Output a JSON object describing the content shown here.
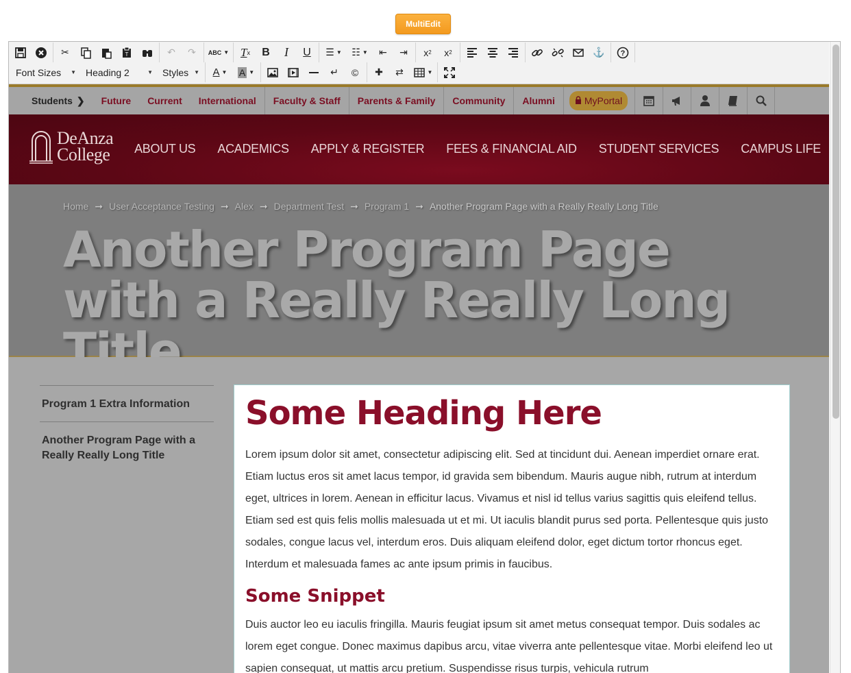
{
  "multiedit": {
    "label": "MultiEdit"
  },
  "toolbar": {
    "font_sizes": "Font Sizes",
    "format": "Heading 2",
    "styles": "Styles"
  },
  "audience": {
    "label": "Students",
    "items": [
      "Future",
      "Current",
      "International",
      "Faculty & Staff",
      "Parents & Family",
      "Community",
      "Alumni"
    ],
    "myportal": "MyPortal",
    "icons": [
      "calendar-icon",
      "megaphone-icon",
      "user-icon",
      "book-icon",
      "search-icon"
    ]
  },
  "brand": {
    "logo_line1": "DeAnza",
    "logo_line2": "College",
    "nav": [
      "ABOUT US",
      "ACADEMICS",
      "APPLY & REGISTER",
      "FEES & FINANCIAL AID",
      "STUDENT SERVICES",
      "CAMPUS LIFE"
    ]
  },
  "breadcrumb": {
    "items": [
      "Home",
      "User Acceptance Testing",
      "Alex",
      "Department Test",
      "Program 1"
    ],
    "current": "Another Program Page with a Really Really Long Title"
  },
  "hero": {
    "title": "Another Program Page with a Really Really Long Title"
  },
  "sidenav": {
    "items": [
      "Program 1 Extra Information",
      "Another Program Page with a Really Really Long Title"
    ]
  },
  "content": {
    "heading": "Some Heading Here",
    "para1": "Lorem ipsum dolor sit amet, consectetur adipiscing elit. Sed at tincidunt dui. Aenean imperdiet ornare erat. Etiam luctus eros sit amet lacus tempor, id gravida sem bibendum. Mauris augue nibh, rutrum at interdum eget, ultrices in lorem. Aenean in efficitur lacus. Vivamus et nisl id tellus varius sagittis quis eleifend tellus. Etiam sed est quis felis mollis malesuada ut et mi. Ut iaculis blandit purus sed porta. Pellentesque quis justo sodales, congue lacus vel, interdum eros. Duis aliquam eleifend dolor, eget dictum tortor rhoncus eget. Interdum et malesuada fames ac ante ipsum primis in faucibus.",
    "subheading": "Some Snippet",
    "para2": "Duis auctor leo eu iaculis fringilla. Mauris feugiat ipsum sit amet metus consequat tempor. Duis sodales ac lorem eget congue. Donec maximus dapibus arcu, vitae viverra ante pellentesque vitae. Morbi eleifend leo ut sapien consequat, ut mattis arcu pretium. Suspendisse risus turpis, vehicula rutrum"
  },
  "colors": {
    "maroon": "#8a0f2a",
    "gold": "#b08a33",
    "multiedit_orange": "#f7a530"
  }
}
